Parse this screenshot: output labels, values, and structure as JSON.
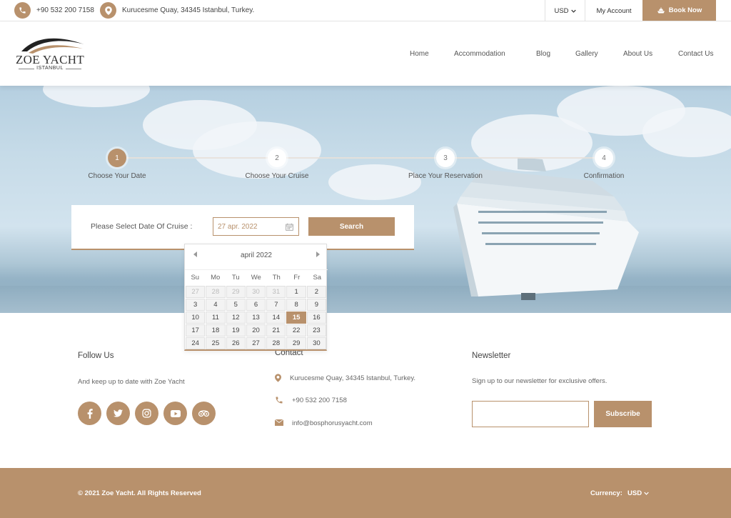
{
  "topbar": {
    "phone": "+90 532 200 7158",
    "address": "Kurucesme Quay, 34345 Istanbul, Turkey.",
    "currency": "USD",
    "my_account": "My Account",
    "book_now": "Book Now"
  },
  "logo": {
    "name": "ZOE YACHT",
    "city": "ISTANBUL"
  },
  "nav": [
    "Home",
    "Accommodation",
    "Blog",
    "Gallery",
    "About Us",
    "Contact Us"
  ],
  "steps": [
    {
      "num": "1",
      "label": "Choose Your Date",
      "active": true
    },
    {
      "num": "2",
      "label": "Choose Your Cruise",
      "active": false
    },
    {
      "num": "3",
      "label": "Place Your Reservation",
      "active": false
    },
    {
      "num": "4",
      "label": "Confirmation",
      "active": false
    }
  ],
  "search_panel": {
    "label": "Please Select Date Of Cruise :",
    "date_value": "27 apr. 2022",
    "search_button": "Search"
  },
  "datepicker": {
    "month": "april 2022",
    "days_of_week": [
      "Su",
      "Mo",
      "Tu",
      "We",
      "Th",
      "Fr",
      "Sa"
    ],
    "weeks": [
      [
        "27",
        "28",
        "29",
        "30",
        "31",
        "1",
        "2"
      ],
      [
        "3",
        "4",
        "5",
        "6",
        "7",
        "8",
        "9"
      ],
      [
        "10",
        "11",
        "12",
        "13",
        "14",
        "15",
        "16"
      ],
      [
        "17",
        "18",
        "19",
        "20",
        "21",
        "22",
        "23"
      ],
      [
        "24",
        "25",
        "26",
        "27",
        "28",
        "29",
        "30"
      ]
    ],
    "selected": "15"
  },
  "footer": {
    "follow_title": "Follow Us",
    "follow_text": "And keep up to date with Zoe Yacht",
    "social_icons": [
      "facebook-icon",
      "twitter-icon",
      "instagram-icon",
      "youtube-icon",
      "tripadvisor-icon"
    ],
    "contact_title": "Contact",
    "contact_address": "Kurucesme Quay, 34345 Istanbul, Turkey.",
    "contact_phone": "+90 532 200 7158",
    "contact_email": "info@bosphorusyacht.com",
    "newsletter_title": "Newsletter",
    "newsletter_text": "Sign up to our newsletter for exclusive offers.",
    "subscribe": "Subscribe"
  },
  "bottom": {
    "copyright": "© 2021 Zoe Yacht. All Rights Reserved",
    "currency_label": "Currency:",
    "currency_value": "USD"
  },
  "colors": {
    "accent": "#b8916c"
  }
}
